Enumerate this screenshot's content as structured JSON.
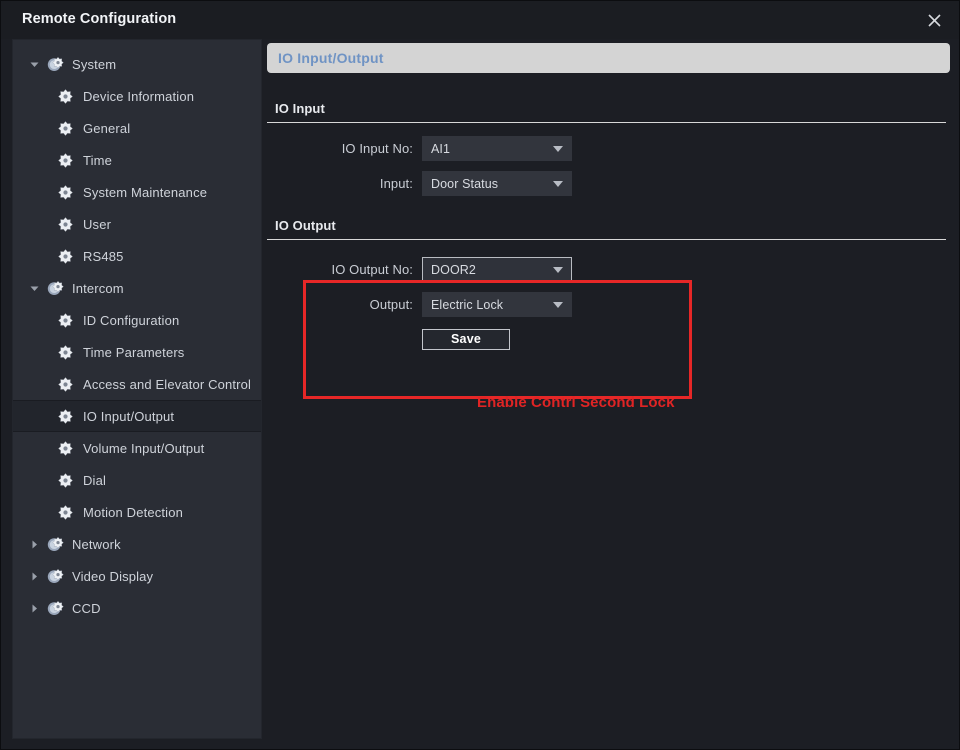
{
  "window": {
    "title": "Remote Configuration",
    "close_icon": "close-icon"
  },
  "sidebar": {
    "items": [
      {
        "label": "System",
        "level": 0,
        "expanded": true,
        "selected": false,
        "icon": "gear-folder-icon"
      },
      {
        "label": "Device Information",
        "level": 1,
        "expanded": null,
        "selected": false,
        "icon": "gear-icon"
      },
      {
        "label": "General",
        "level": 1,
        "expanded": null,
        "selected": false,
        "icon": "gear-icon"
      },
      {
        "label": "Time",
        "level": 1,
        "expanded": null,
        "selected": false,
        "icon": "gear-icon"
      },
      {
        "label": "System Maintenance",
        "level": 1,
        "expanded": null,
        "selected": false,
        "icon": "gear-icon"
      },
      {
        "label": "User",
        "level": 1,
        "expanded": null,
        "selected": false,
        "icon": "gear-icon"
      },
      {
        "label": "RS485",
        "level": 1,
        "expanded": null,
        "selected": false,
        "icon": "gear-icon"
      },
      {
        "label": "Intercom",
        "level": 0,
        "expanded": true,
        "selected": false,
        "icon": "gear-folder-icon"
      },
      {
        "label": "ID Configuration",
        "level": 1,
        "expanded": null,
        "selected": false,
        "icon": "gear-icon"
      },
      {
        "label": "Time Parameters",
        "level": 1,
        "expanded": null,
        "selected": false,
        "icon": "gear-icon"
      },
      {
        "label": "Access and Elevator Control",
        "level": 1,
        "expanded": null,
        "selected": false,
        "icon": "gear-icon"
      },
      {
        "label": "IO Input/Output",
        "level": 1,
        "expanded": null,
        "selected": true,
        "icon": "gear-icon"
      },
      {
        "label": "Volume Input/Output",
        "level": 1,
        "expanded": null,
        "selected": false,
        "icon": "gear-icon"
      },
      {
        "label": "Dial",
        "level": 1,
        "expanded": null,
        "selected": false,
        "icon": "gear-icon"
      },
      {
        "label": "Motion Detection",
        "level": 1,
        "expanded": null,
        "selected": false,
        "icon": "gear-icon"
      },
      {
        "label": "Network",
        "level": 0,
        "expanded": false,
        "selected": false,
        "icon": "gear-folder-icon"
      },
      {
        "label": "Video Display",
        "level": 0,
        "expanded": false,
        "selected": false,
        "icon": "gear-folder-icon"
      },
      {
        "label": "CCD",
        "level": 0,
        "expanded": false,
        "selected": false,
        "icon": "gear-folder-icon"
      }
    ]
  },
  "main": {
    "page_title": "IO Input/Output",
    "io_input": {
      "section_title": "IO Input",
      "fields": [
        {
          "label": "IO Input No:",
          "value": "AI1",
          "focused": false
        },
        {
          "label": "Input:",
          "value": "Door Status",
          "focused": false
        }
      ]
    },
    "io_output": {
      "section_title": "IO Output",
      "fields": [
        {
          "label": "IO Output No:",
          "value": "DOOR2",
          "focused": true
        },
        {
          "label": "Output:",
          "value": "Electric Lock",
          "focused": false
        }
      ],
      "save_label": "Save"
    },
    "annotation": "Enable Contrl Second Lock"
  },
  "colors": {
    "annotation_red": "#e02424",
    "highlight_red": "#e62727",
    "header_bar": "#d4d4d4",
    "header_text": "#6f93c4",
    "window_bg": "#1c1e24",
    "sidebar_bg": "#2a2d35"
  }
}
